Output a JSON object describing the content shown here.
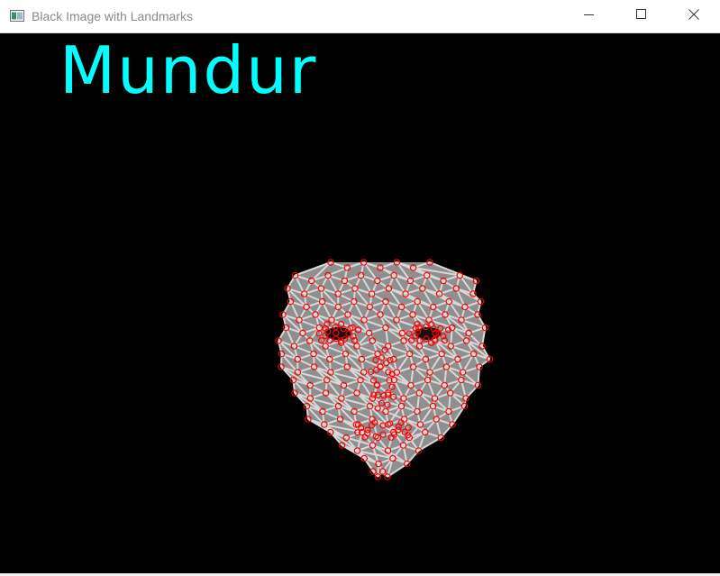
{
  "window": {
    "title": "Black Image with Landmarks",
    "icon": "opencv-window-icon",
    "controls": {
      "minimize_icon": "minimize-icon",
      "maximize_icon": "maximize-icon",
      "close_icon": "close-icon"
    }
  },
  "canvas": {
    "background": "#000000",
    "label": "Mundur",
    "label_color": "#00ffff",
    "mesh_line_color": "#d8d8d8",
    "landmark_color": "#ff0000"
  }
}
